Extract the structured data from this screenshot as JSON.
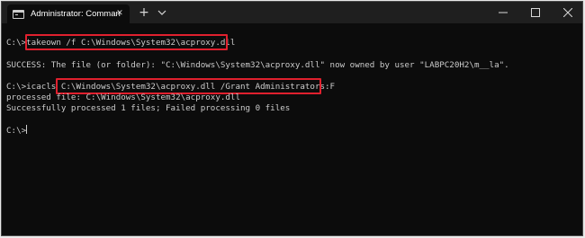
{
  "window": {
    "tab_title": "Administrator: Command Promp",
    "tab_close_icon": "close-icon",
    "new_tab_symbol": "+",
    "dropdown_icon": "chevron-down-icon",
    "controls": [
      "minimize-icon",
      "maximize-icon",
      "close-icon"
    ]
  },
  "terminal": {
    "lines": [
      {
        "prompt": "C:\\>",
        "command": "takeown /f C:\\Windows\\System32\\acproxy.dll"
      },
      {
        "text": "SUCCESS: The file (or folder): \"C:\\Windows\\System32\\acproxy.dll\" now owned by user \"LABPC20H2\\m__la\"."
      },
      {
        "prompt": "C:\\>icacls ",
        "command": "C:\\Windows\\System32\\acproxy.dll /Grant Administrators:F"
      },
      {
        "text": "processed file: C:\\Windows\\System32\\acproxy.dll"
      },
      {
        "text": "Successfully processed 1 files; Failed processing 0 files"
      },
      {
        "prompt": "C:\\>"
      }
    ]
  },
  "colors": {
    "terminal_bg": "#0c0c0c",
    "terminal_text": "#cccccc",
    "titlebar_bg": "#1f1f1f",
    "highlight": "#e0202e"
  }
}
